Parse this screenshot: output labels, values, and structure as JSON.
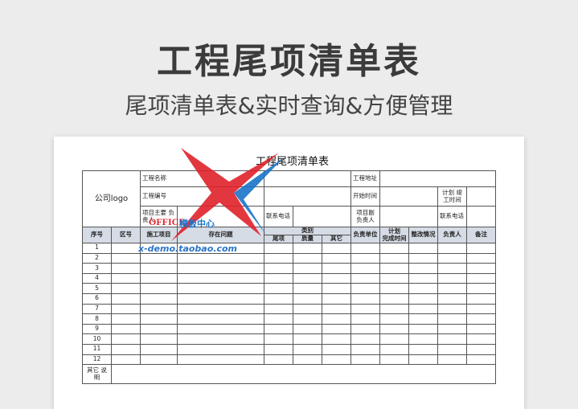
{
  "hero": {
    "title": "工程尾项清单表",
    "subtitle": "尾项清单表&实时查询&方便管理"
  },
  "sheet": {
    "title": "工程尾项清单表",
    "logo": "公司logo",
    "fields": {
      "project_name": "工程名称",
      "project_address": "工程地址",
      "project_code": "工程编号",
      "start_time": "开始时间",
      "plan_finish": "计划\n竣工时间",
      "main_leader": "项目主要\n负责人",
      "phone1": "联系电话",
      "deputy_leader": "项目副\n负责人",
      "phone2": "联系电话"
    },
    "columns": {
      "no": "序号",
      "zone": "区号",
      "item": "施工项目",
      "issue": "存在问题",
      "category": "类别",
      "cat_tail": "尾项",
      "cat_quality": "质量",
      "cat_other": "其它",
      "unit": "负责单位",
      "plan_time": "计划\n完成时间",
      "status": "整改情况",
      "owner": "负责人",
      "remark": "备注"
    },
    "rows": [
      "1",
      "2",
      "3",
      "4",
      "5",
      "6",
      "7",
      "8",
      "9",
      "10",
      "11",
      "12"
    ],
    "footer": "其它\n说明"
  },
  "watermark": {
    "brand": "OFFICE",
    "center": "模板中心",
    "url": "x-demo.taobao.com"
  },
  "colors": {
    "header_fill": "#d6dce5",
    "watermark_red": "#e0212a",
    "watermark_blue": "#1a73c9"
  }
}
